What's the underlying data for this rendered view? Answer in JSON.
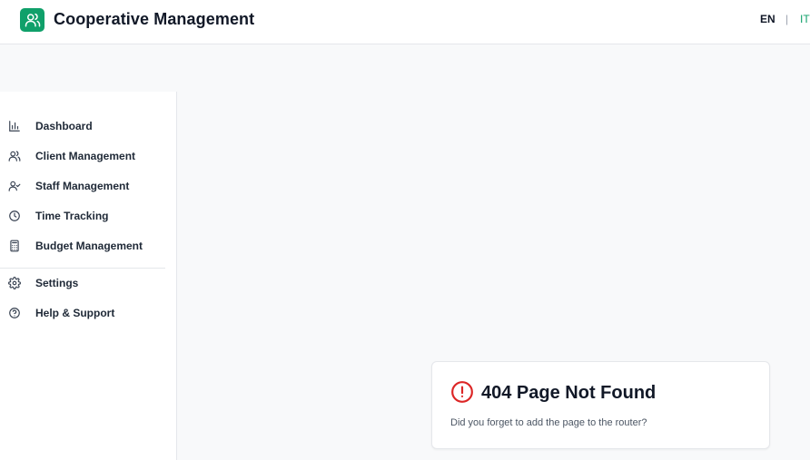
{
  "header": {
    "app_title": "Cooperative Management",
    "logo_icon": "users-icon",
    "lang_en": "EN",
    "lang_separator": "|",
    "lang_it": "IT",
    "accent_color": "#10a06a"
  },
  "sidebar": {
    "items": [
      {
        "label": "Dashboard",
        "icon": "bar-chart-icon"
      },
      {
        "label": "Client Management",
        "icon": "users-icon"
      },
      {
        "label": "Staff Management",
        "icon": "user-check-icon"
      },
      {
        "label": "Time Tracking",
        "icon": "clock-icon"
      },
      {
        "label": "Budget Management",
        "icon": "calculator-icon"
      }
    ],
    "footer_items": [
      {
        "label": "Settings",
        "icon": "gear-icon"
      },
      {
        "label": "Help & Support",
        "icon": "help-circle-icon"
      }
    ]
  },
  "error_card": {
    "title": "404 Page Not Found",
    "message": "Did you forget to add the page to the router?",
    "icon": "alert-circle-icon",
    "icon_color": "#dc2626"
  }
}
